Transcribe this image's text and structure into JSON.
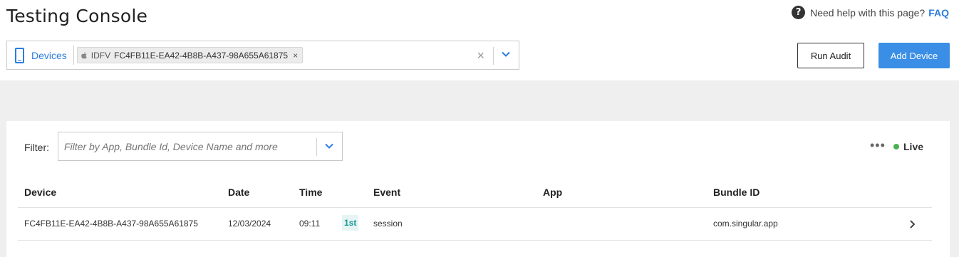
{
  "page": {
    "title": "Testing Console"
  },
  "help": {
    "text": "Need help with this page?",
    "link": "FAQ"
  },
  "device_selector": {
    "label": "Devices",
    "chip_type": "IDFV",
    "chip_value": "FC4FB11E-EA42-4B8B-A437-98A655A61875",
    "chip_remove": "×",
    "clear": "×"
  },
  "buttons": {
    "run_audit": "Run Audit",
    "add_device": "Add Device"
  },
  "filter": {
    "label": "Filter:",
    "placeholder": "Filter by App, Bundle Id, Device Name and more"
  },
  "status": {
    "more": "•••",
    "live": "Live"
  },
  "table": {
    "columns": [
      "Device",
      "Date",
      "Time",
      "Event",
      "App",
      "Bundle ID"
    ],
    "rows": [
      {
        "device": "FC4FB11E-EA42-4B8B-A437-98A655A61875",
        "date": "12/03/2024",
        "time": "09:11",
        "badge": "1st",
        "event": "session",
        "app": "",
        "bundle_id": "com.singular.app"
      }
    ]
  },
  "colors": {
    "accent": "#2b7de0",
    "primary_button": "#3a8ee6",
    "live": "#4caf50",
    "badge_text": "#1a9a96",
    "badge_bg": "#e6f4f4"
  },
  "icons": {
    "help": "question-circle-icon",
    "devices": "phone-icon",
    "chip_os": "apple-icon",
    "dropdown": "chevron-down-icon",
    "row": "chevron-right-icon",
    "more": "more-dots-icon"
  }
}
